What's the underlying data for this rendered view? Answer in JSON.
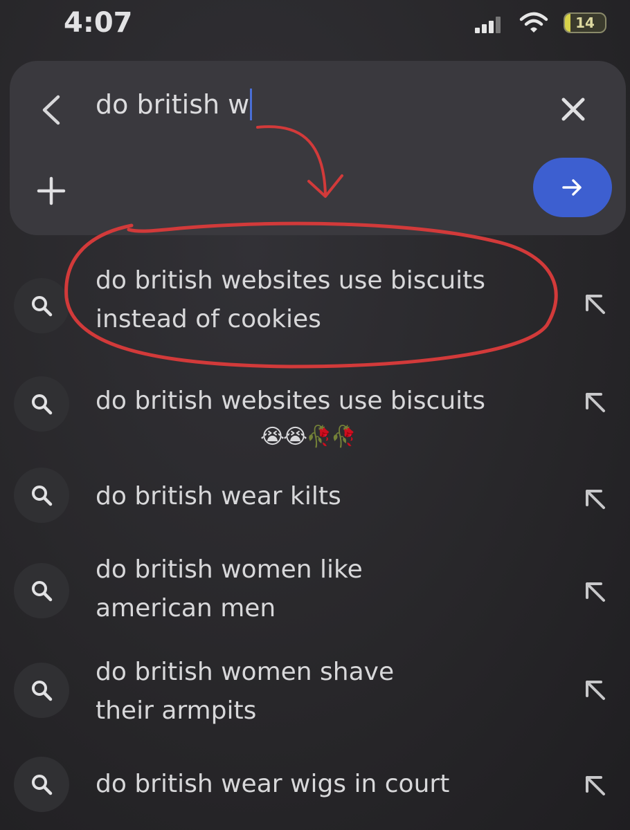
{
  "status_bar": {
    "time": "4:07",
    "battery": "14",
    "icons": [
      "signal-icon",
      "wifi-icon",
      "battery-icon"
    ]
  },
  "search": {
    "query": "do british w",
    "icons": [
      "back-icon",
      "clear-icon",
      "plus-icon",
      "arrow-right-icon"
    ],
    "accent_color": "#3d5fd0"
  },
  "suggestions": [
    {
      "lines": [
        "do british websites use biscuits",
        "instead of cookies"
      ],
      "highlighted": true
    },
    {
      "lines": [
        "do british websites use biscuits",
        ""
      ],
      "emoji": "😭😭🥀🥀"
    },
    {
      "lines": [
        "do british wear kilts",
        ""
      ]
    },
    {
      "lines": [
        "do british women like",
        "american men"
      ]
    },
    {
      "lines": [
        "do british women shave",
        "their armpits"
      ]
    },
    {
      "lines": [
        "do british wear wigs in court",
        ""
      ]
    }
  ],
  "colors": {
    "background": "#2b2a2d",
    "panel": "#3a393e",
    "annotation": "#d23a3a"
  }
}
